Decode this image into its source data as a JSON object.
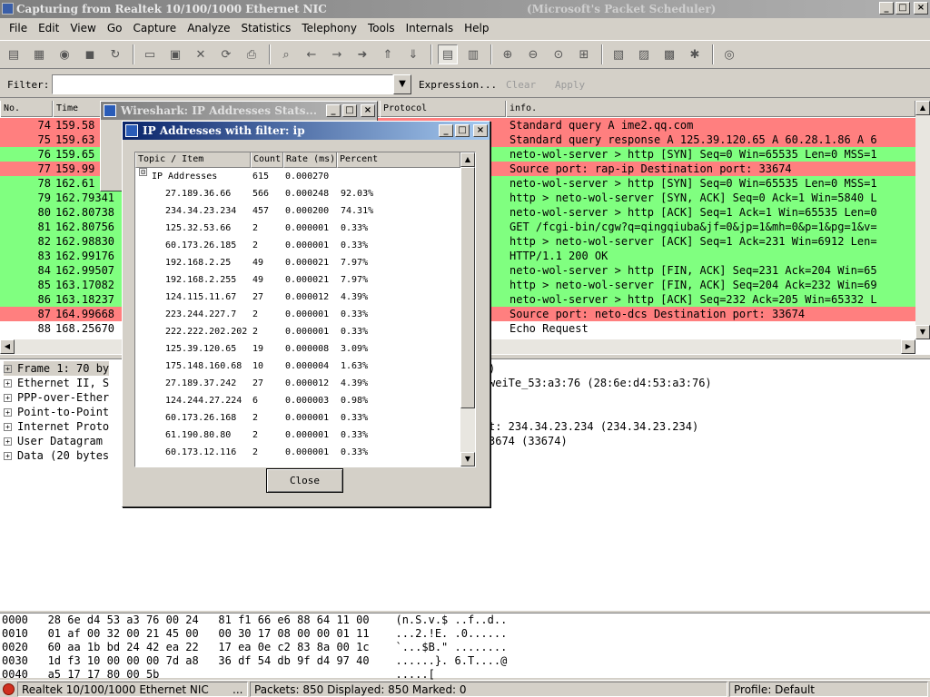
{
  "window": {
    "title": "Capturing from Realtek 10/100/1000 Ethernet NIC",
    "title_suffix": "(Microsoft's Packet Scheduler)",
    "min_glyph": "_",
    "max_glyph": "□",
    "close_glyph": "×"
  },
  "menu": [
    "File",
    "Edit",
    "View",
    "Go",
    "Capture",
    "Analyze",
    "Statistics",
    "Telephony",
    "Tools",
    "Internals",
    "Help"
  ],
  "toolbar": {
    "groups": [
      [
        {
          "icon": "interface-list-icon",
          "glyph": "▤"
        },
        {
          "icon": "capture-options-icon",
          "glyph": "▦"
        },
        {
          "icon": "start-capture-icon",
          "glyph": "◉"
        },
        {
          "icon": "stop-capture-icon",
          "glyph": "◼"
        },
        {
          "icon": "restart-capture-icon",
          "glyph": "↻"
        }
      ],
      [
        {
          "icon": "open-file-icon",
          "glyph": "▭"
        },
        {
          "icon": "save-file-icon",
          "glyph": "▣"
        },
        {
          "icon": "close-file-icon",
          "glyph": "✕"
        },
        {
          "icon": "reload-icon",
          "glyph": "⟳"
        },
        {
          "icon": "print-icon",
          "glyph": "⎙"
        }
      ],
      [
        {
          "icon": "find-packet-icon",
          "glyph": "⌕"
        },
        {
          "icon": "go-back-icon",
          "glyph": "←"
        },
        {
          "icon": "go-forward-icon",
          "glyph": "→"
        },
        {
          "icon": "go-to-packet-icon",
          "glyph": "➜"
        },
        {
          "icon": "go-first-icon",
          "glyph": "⇑"
        },
        {
          "icon": "go-last-icon",
          "glyph": "⇓"
        }
      ],
      [
        {
          "icon": "colorize-icon",
          "glyph": "▤",
          "active": true
        },
        {
          "icon": "auto-scroll-icon",
          "glyph": "▥"
        }
      ],
      [
        {
          "icon": "zoom-in-icon",
          "glyph": "⊕"
        },
        {
          "icon": "zoom-out-icon",
          "glyph": "⊖"
        },
        {
          "icon": "normal-size-icon",
          "glyph": "⊙"
        },
        {
          "icon": "resize-columns-icon",
          "glyph": "⊞"
        }
      ],
      [
        {
          "icon": "capture-filters-icon",
          "glyph": "▧"
        },
        {
          "icon": "display-filters-icon",
          "glyph": "▨"
        },
        {
          "icon": "coloring-rules-icon",
          "glyph": "▩"
        },
        {
          "icon": "preferences-icon",
          "glyph": "✱"
        }
      ],
      [
        {
          "icon": "help-icon",
          "glyph": "◎"
        }
      ]
    ]
  },
  "filter": {
    "label": "Filter:",
    "value": "",
    "dropdown_glyph": "▼",
    "expression_label": "Expression...",
    "clear_label": "Clear",
    "apply_label": "Apply"
  },
  "packet_list": {
    "columns": [
      "No.",
      "Time",
      "Protocol",
      "info."
    ],
    "rows": [
      {
        "no": "74",
        "time": "159.58",
        "info": "Standard query A ime2.qq.com",
        "bg": "#ff7f7f"
      },
      {
        "no": "75",
        "time": "159.63",
        "info": "Standard query response A 125.39.120.65 A 60.28.1.86 A 6",
        "bg": "#ff7f7f"
      },
      {
        "no": "76",
        "time": "159.65",
        "info": "neto-wol-server > http [SYN] Seq=0 Win=65535 Len=0 MSS=1",
        "bg": "#80ff80"
      },
      {
        "no": "77",
        "time": "159.99",
        "info": "Source port: rap-ip  Destination port: 33674",
        "bg": "#ff7f7f"
      },
      {
        "no": "78",
        "time": "162.61",
        "info": "neto-wol-server > http [SYN] Seq=0 Win=65535 Len=0 MSS=1",
        "bg": "#80ff80"
      },
      {
        "no": "79",
        "time": "162.79341",
        "info": "http > neto-wol-server [SYN, ACK] Seq=0 Ack=1 Win=5840 L",
        "bg": "#80ff80"
      },
      {
        "no": "80",
        "time": "162.80738",
        "info": "neto-wol-server > http [ACK] Seq=1 Ack=1 Win=65535 Len=0",
        "bg": "#80ff80"
      },
      {
        "no": "81",
        "time": "162.80756",
        "info": "GET /fcgi-bin/cgw?q=qingqiuba&jf=0&jp=1&mh=0&p=1&pg=1&v=",
        "bg": "#80ff80"
      },
      {
        "no": "82",
        "time": "162.98830",
        "info": "http > neto-wol-server [ACK] Seq=1 Ack=231 Win=6912 Len=",
        "bg": "#80ff80"
      },
      {
        "no": "83",
        "time": "162.99176",
        "info": "HTTP/1.1 200 OK",
        "bg": "#80ff80"
      },
      {
        "no": "84",
        "time": "162.99507",
        "info": "neto-wol-server > http [FIN, ACK] Seq=231 Ack=204 Win=65",
        "bg": "#80ff80"
      },
      {
        "no": "85",
        "time": "163.17082",
        "info": "http > neto-wol-server [FIN, ACK] Seq=204 Ack=232 Win=69",
        "bg": "#80ff80"
      },
      {
        "no": "86",
        "time": "163.18237",
        "info": "neto-wol-server > http [ACK] Seq=232 Ack=205 Win=65332 L",
        "bg": "#80ff80"
      },
      {
        "no": "87",
        "time": "164.99668",
        "info": "Source port: neto-dcs  Destination port: 33674",
        "bg": "#ff7f7f"
      },
      {
        "no": "88",
        "time": "168.25670",
        "info": "Echo Request",
        "bg": "#ffffff"
      }
    ]
  },
  "detail_tree": [
    {
      "label": "Frame 1: 70 by",
      "tail": ")"
    },
    {
      "label": "Ethernet II, S",
      "tail": "weiTe_53:a3:76 (28:6e:d4:53:a3:76)"
    },
    {
      "label": "PPP-over-Ether",
      "tail": ""
    },
    {
      "label": "Point-to-Point",
      "tail": ""
    },
    {
      "label": "Internet Proto",
      "tail": "t: 234.34.23.234 (234.34.23.234)"
    },
    {
      "label": "User Datagram",
      "tail": "3674 (33674)"
    },
    {
      "label": "Data (20 bytes",
      "tail": ""
    }
  ],
  "hex_dump": [
    "0000   28 6e d4 53 a3 76 00 24   81 f1 66 e6 88 64 11 00    (n.S.v.$ ..f..d..",
    "0010   01 af 00 32 00 21 45 00   00 30 17 08 00 00 01 11    ...2.!E. .0......",
    "0020   60 aa 1b bd 24 42 ea 22   17 ea 0e c2 83 8a 00 1c    `...$B.\" ........",
    "0030   1d f3 10 00 00 00 7d a8   36 df 54 db 9f d4 97 40    ......}. 6.T....@",
    "0040   a5 17 17 80 00 5b                                    .....["
  ],
  "status": {
    "interface": "Realtek 10/100/1000 Ethernet NIC",
    "ellipsis": "...",
    "packets": "Packets: 850 Displayed: 850 Marked: 0",
    "profile": "Profile: Default"
  },
  "back_dialog": {
    "title": "Wireshark: IP Addresses Stats..."
  },
  "stats_dialog": {
    "title": "IP Addresses with filter: ip",
    "columns": [
      "Topic / Item",
      "Count",
      "Rate (ms)",
      "Percent"
    ],
    "root": {
      "name": "IP Addresses",
      "count": "615",
      "rate": "0.000270",
      "pct": "",
      "expander": "⊟"
    },
    "rows": [
      {
        "name": "27.189.36.66",
        "count": "566",
        "rate": "0.000248",
        "pct": "92.03%"
      },
      {
        "name": "234.34.23.234",
        "count": "457",
        "rate": "0.000200",
        "pct": "74.31%"
      },
      {
        "name": "125.32.53.66",
        "count": "2",
        "rate": "0.000001",
        "pct": "0.33%"
      },
      {
        "name": "60.173.26.185",
        "count": "2",
        "rate": "0.000001",
        "pct": "0.33%"
      },
      {
        "name": "192.168.2.25",
        "count": "49",
        "rate": "0.000021",
        "pct": "7.97%"
      },
      {
        "name": "192.168.2.255",
        "count": "49",
        "rate": "0.000021",
        "pct": "7.97%"
      },
      {
        "name": "124.115.11.67",
        "count": "27",
        "rate": "0.000012",
        "pct": "4.39%"
      },
      {
        "name": "223.244.227.7",
        "count": "2",
        "rate": "0.000001",
        "pct": "0.33%"
      },
      {
        "name": "222.222.202.202",
        "count": "2",
        "rate": "0.000001",
        "pct": "0.33%"
      },
      {
        "name": "125.39.120.65",
        "count": "19",
        "rate": "0.000008",
        "pct": "3.09%"
      },
      {
        "name": "175.148.160.68",
        "count": "10",
        "rate": "0.000004",
        "pct": "1.63%"
      },
      {
        "name": "27.189.37.242",
        "count": "27",
        "rate": "0.000012",
        "pct": "4.39%"
      },
      {
        "name": "124.244.27.224",
        "count": "6",
        "rate": "0.000003",
        "pct": "0.98%"
      },
      {
        "name": "60.173.26.168",
        "count": "2",
        "rate": "0.000001",
        "pct": "0.33%"
      },
      {
        "name": "61.190.80.80",
        "count": "2",
        "rate": "0.000001",
        "pct": "0.33%"
      },
      {
        "name": "60.173.12.116",
        "count": "2",
        "rate": "0.000001",
        "pct": "0.33%"
      }
    ],
    "close_label": "Close"
  }
}
